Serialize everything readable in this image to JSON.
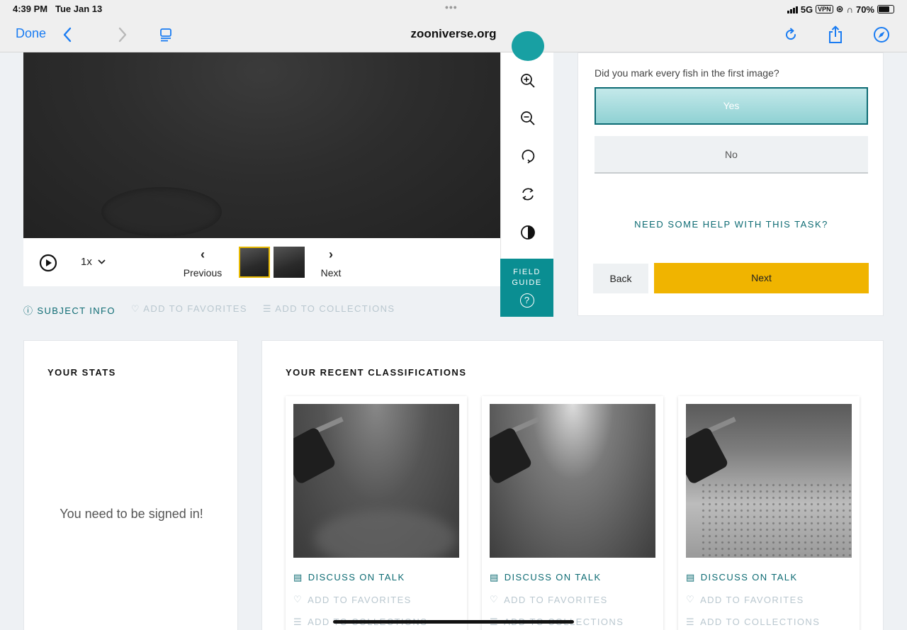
{
  "status_bar": {
    "time": "4:39 PM",
    "date": "Tue Jan 13",
    "network": "5G",
    "vpn": "VPN",
    "battery": "70%",
    "battery_level": 0.7
  },
  "browser": {
    "done_label": "Done",
    "url": "zooniverse.org"
  },
  "viewer": {
    "speed": "1x",
    "previous_label": "Previous",
    "next_label": "Next",
    "frames": 2,
    "active_frame": 1
  },
  "field_guide": {
    "line1": "FIELD",
    "line2": "GUIDE",
    "help_glyph": "?"
  },
  "subject_meta": {
    "subject_info": "SUBJECT INFO",
    "add_to_favorites": "ADD TO FAVORITES",
    "add_to_collections": "ADD TO COLLECTIONS"
  },
  "task": {
    "question": "Did you mark every fish in the first image?",
    "answers": [
      "Yes",
      "No"
    ],
    "selected_answer": "Yes",
    "help_link": "NEED SOME HELP WITH THIS TASK?",
    "back_label": "Back",
    "next_label": "Next"
  },
  "stats": {
    "title": "YOUR STATS",
    "message": "You need to be signed in!"
  },
  "recent": {
    "title": "YOUR RECENT CLASSIFICATIONS",
    "cards": [
      {
        "discuss": "DISCUSS ON TALK",
        "favorites": "ADD TO FAVORITES",
        "collections": "ADD TO COLLECTIONS"
      },
      {
        "discuss": "DISCUSS ON TALK",
        "favorites": "ADD TO FAVORITES",
        "collections": "ADD TO COLLECTIONS"
      },
      {
        "discuss": "DISCUSS ON TALK",
        "favorites": "ADD TO FAVORITES",
        "collections": "ADD TO COLLECTIONS"
      }
    ]
  },
  "colors": {
    "teal": "#0d6b73",
    "teal_bright": "#18a0a3",
    "yellow": "#f0b400",
    "link_blue": "#1a7cf2"
  },
  "icons": {
    "toolbar": [
      "chevron-left-icon",
      "chevron-right-icon",
      "reader-icon",
      "reload-icon",
      "share-icon",
      "compass-icon"
    ],
    "tools": [
      "zoom-in-icon",
      "zoom-out-icon",
      "rotate-icon",
      "reset-icon",
      "contrast-icon"
    ]
  }
}
